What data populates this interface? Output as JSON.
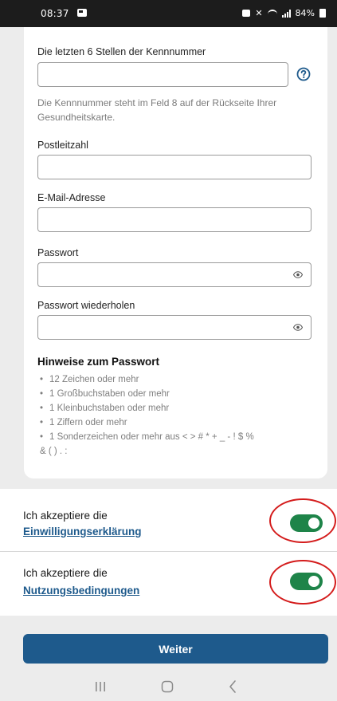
{
  "status_bar": {
    "time": "08:37",
    "battery": "84%",
    "icons": [
      "notification-icon",
      "mute-icon",
      "vibrate-icon",
      "wifi-icon",
      "signal-icon",
      "battery-icon"
    ]
  },
  "form": {
    "id_number": {
      "label": "Die letzten 6 Stellen der Kennnummer",
      "value": "",
      "hint": "Die Kennnummer steht im Feld 8 auf der Rückseite Ihrer Gesundheitskarte."
    },
    "postal_code": {
      "label": "Postleitzahl",
      "value": ""
    },
    "email": {
      "label": "E-Mail-Adresse",
      "value": ""
    },
    "password": {
      "label": "Passwort",
      "value": ""
    },
    "password_repeat": {
      "label": "Passwort wiederholen",
      "value": ""
    }
  },
  "password_hints": {
    "title": "Hinweise zum Passwort",
    "rules": [
      "12 Zeichen oder mehr",
      "1 Großbuchstaben oder mehr",
      "1 Kleinbuchstaben oder mehr",
      "1 Ziffern oder mehr",
      "1 Sonderzeichen oder mehr aus < > # * + _ - ! $ %"
    ],
    "rules_tail": "& ( ) . :"
  },
  "consents": [
    {
      "text": "Ich akzeptiere die",
      "link": "Einwilligungserklärung",
      "checked": true
    },
    {
      "text": "Ich akzeptiere die",
      "link": "Nutzungsbedingungen",
      "checked": true
    }
  ],
  "actions": {
    "continue_label": "Weiter"
  },
  "colors": {
    "primary": "#1e5a8c",
    "toggle_on": "#1e8449",
    "annotation": "#d41c1c",
    "hint_text": "#7b7b7b"
  }
}
